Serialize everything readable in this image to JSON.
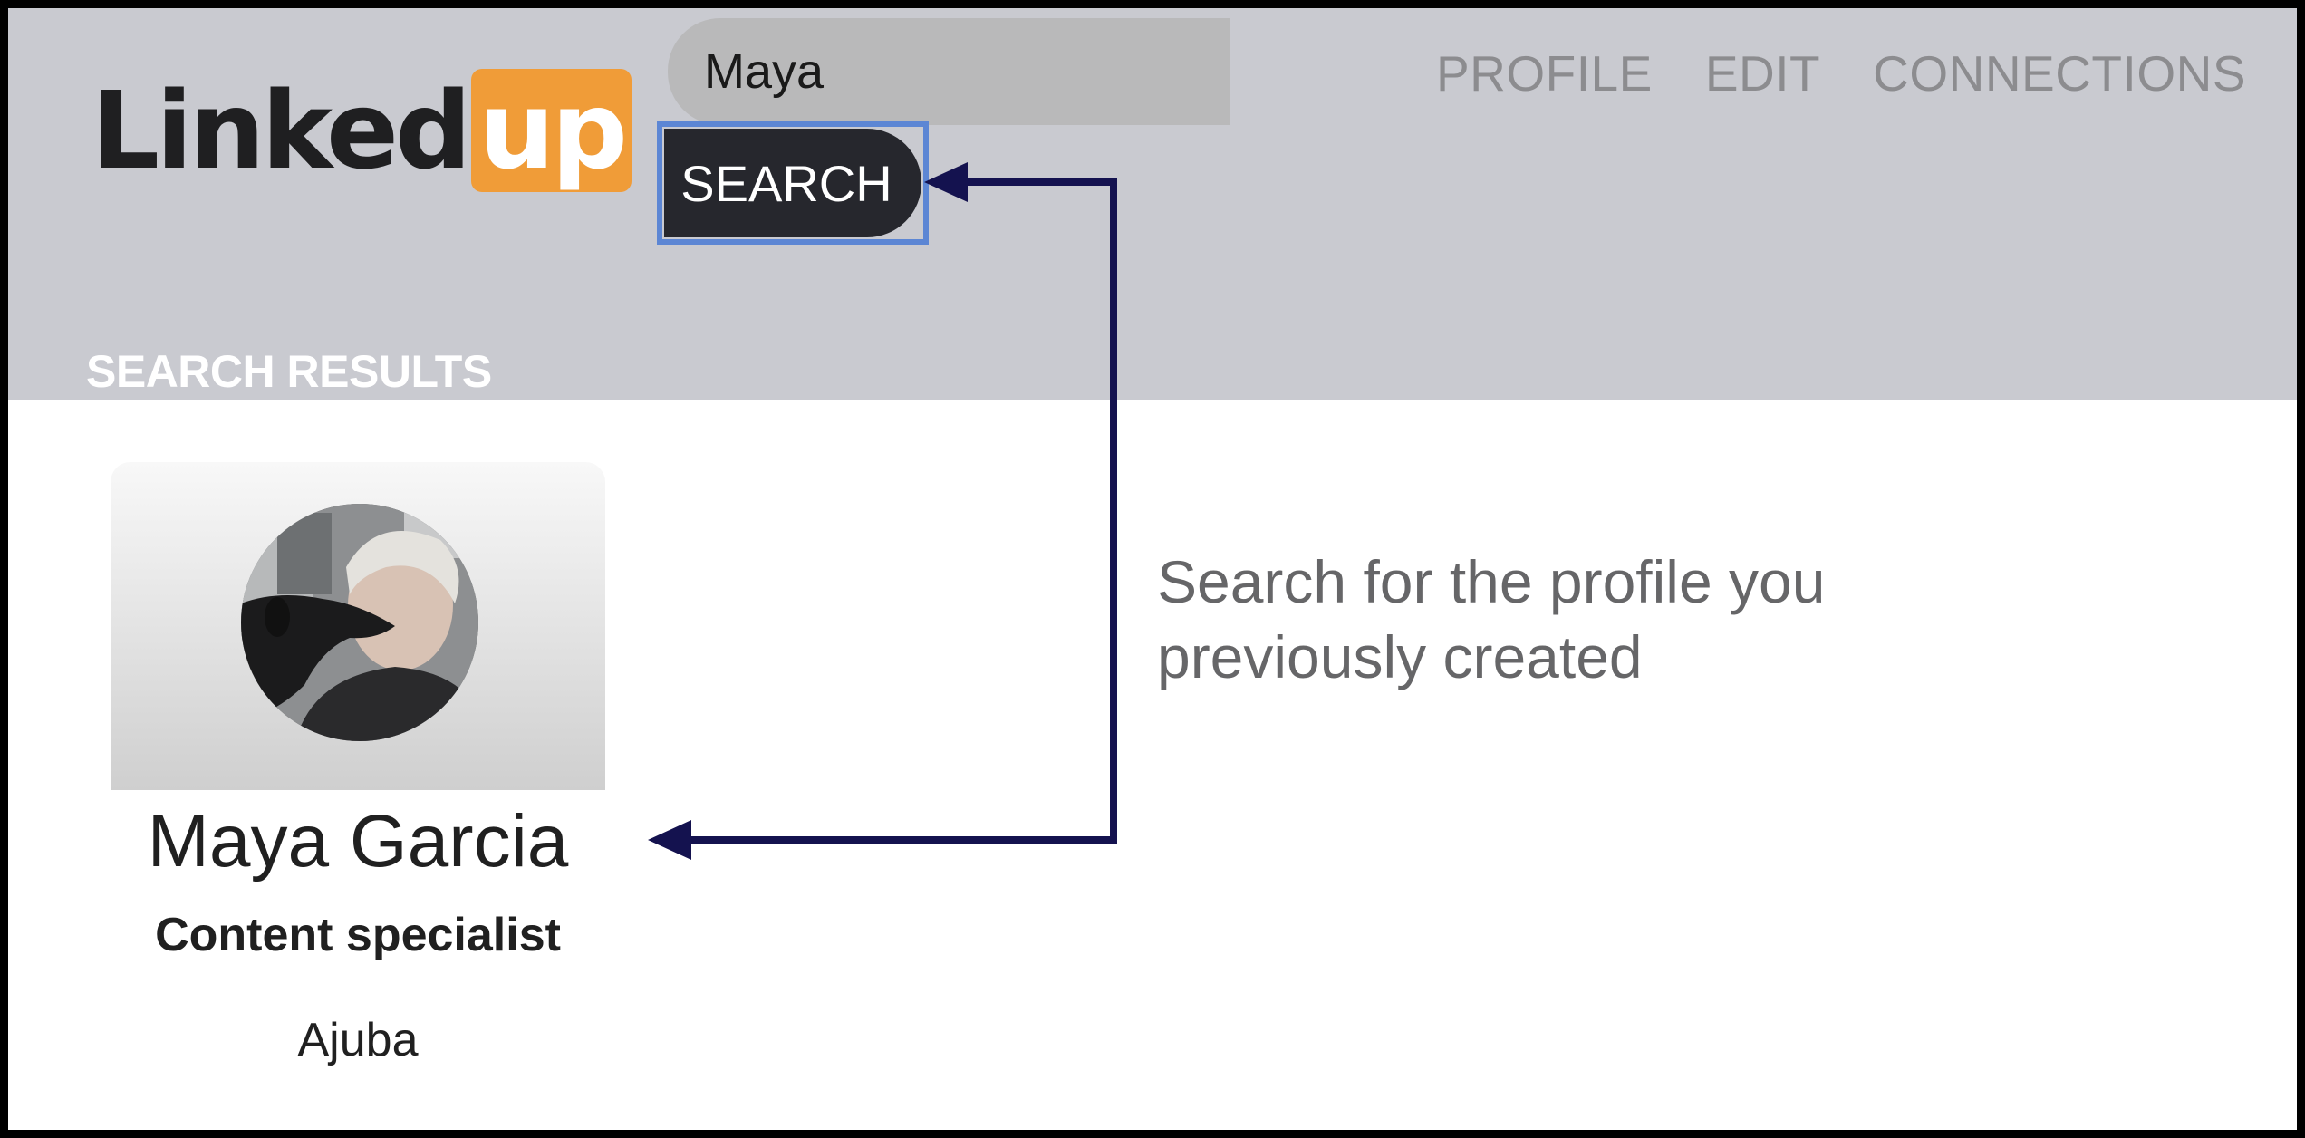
{
  "logo": {
    "part1": "Linked",
    "part2": "up",
    "accent_color": "#f09c38"
  },
  "search": {
    "value": "Maya",
    "button_label": "SEARCH"
  },
  "nav": {
    "items": [
      {
        "label": "PROFILE"
      },
      {
        "label": "EDIT"
      },
      {
        "label": "CONNECTIONS"
      }
    ]
  },
  "results": {
    "heading": "SEARCH RESULTS",
    "cards": [
      {
        "name": "Maya Garcia",
        "title": "Content specialist",
        "company": "Ajuba",
        "avatar_icon": "profile-photo"
      }
    ]
  },
  "annotation": {
    "text": "Search for the profile you previously created",
    "arrow_color": "#14124f"
  },
  "colors": {
    "header_bg": "#c9cad0",
    "button_bg": "#26272d",
    "focus_ring": "#5c86d4"
  }
}
